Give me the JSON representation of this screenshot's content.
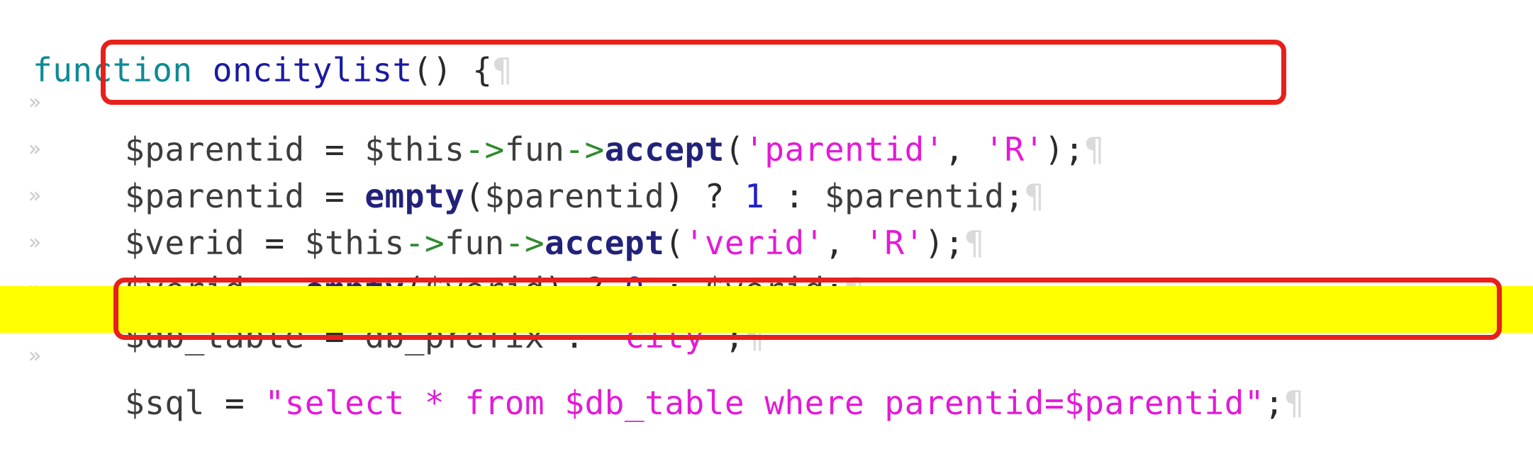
{
  "editor": {
    "lines": [
      {
        "tab": "",
        "pilcrow": "¶",
        "tokens": [
          {
            "t": "function",
            "c": "kw"
          },
          {
            "t": " ",
            "c": "op"
          },
          {
            "t": "oncitylist",
            "c": "fn"
          },
          {
            "t": "() {",
            "c": "pun"
          }
        ]
      },
      {
        "tab": "»",
        "pilcrow": "¶",
        "tokens": [
          {
            "t": "$parentid",
            "c": "var"
          },
          {
            "t": " = ",
            "c": "op"
          },
          {
            "t": "$this",
            "c": "var"
          },
          {
            "t": "->",
            "c": "arr"
          },
          {
            "t": "fun",
            "c": "var"
          },
          {
            "t": "->",
            "c": "arr"
          },
          {
            "t": "accept",
            "c": "mth"
          },
          {
            "t": "(",
            "c": "pun"
          },
          {
            "t": "'parentid'",
            "c": "str"
          },
          {
            "t": ", ",
            "c": "pun"
          },
          {
            "t": "'R'",
            "c": "str"
          },
          {
            "t": ");",
            "c": "pun"
          }
        ]
      },
      {
        "tab": "»",
        "pilcrow": "¶",
        "tokens": [
          {
            "t": "$parentid",
            "c": "var"
          },
          {
            "t": " = ",
            "c": "op"
          },
          {
            "t": "empty",
            "c": "mth"
          },
          {
            "t": "(",
            "c": "pun"
          },
          {
            "t": "$parentid",
            "c": "var"
          },
          {
            "t": ") ? ",
            "c": "pun"
          },
          {
            "t": "1",
            "c": "num"
          },
          {
            "t": " : ",
            "c": "pun"
          },
          {
            "t": "$parentid",
            "c": "var"
          },
          {
            "t": ";",
            "c": "pun"
          }
        ]
      },
      {
        "tab": "»",
        "pilcrow": "¶",
        "tokens": [
          {
            "t": "$verid",
            "c": "var"
          },
          {
            "t": " = ",
            "c": "op"
          },
          {
            "t": "$this",
            "c": "var"
          },
          {
            "t": "->",
            "c": "arr"
          },
          {
            "t": "fun",
            "c": "var"
          },
          {
            "t": "->",
            "c": "arr"
          },
          {
            "t": "accept",
            "c": "mth"
          },
          {
            "t": "(",
            "c": "pun"
          },
          {
            "t": "'verid'",
            "c": "str"
          },
          {
            "t": ", ",
            "c": "pun"
          },
          {
            "t": "'R'",
            "c": "str"
          },
          {
            "t": ");",
            "c": "pun"
          }
        ]
      },
      {
        "tab": "»",
        "pilcrow": "¶",
        "tokens": [
          {
            "t": "$verid",
            "c": "var"
          },
          {
            "t": " = ",
            "c": "op"
          },
          {
            "t": "empty",
            "c": "mth"
          },
          {
            "t": "(",
            "c": "pun"
          },
          {
            "t": "$verid",
            "c": "var"
          },
          {
            "t": ") ? ",
            "c": "pun"
          },
          {
            "t": "0",
            "c": "num"
          },
          {
            "t": " : ",
            "c": "pun"
          },
          {
            "t": "$verid",
            "c": "var"
          },
          {
            "t": ";",
            "c": "pun"
          }
        ]
      },
      {
        "tab": "»",
        "pilcrow": "¶",
        "tokens": [
          {
            "t": "$db_table",
            "c": "var"
          },
          {
            "t": " = ",
            "c": "op"
          },
          {
            "t": "db_prefix",
            "c": "var"
          },
          {
            "t": " . ",
            "c": "op"
          },
          {
            "t": "'city'",
            "c": "str"
          },
          {
            "t": ";",
            "c": "pun"
          }
        ]
      },
      {
        "tab": "»",
        "pilcrow": "¶",
        "tokens": [
          {
            "t": "$sql",
            "c": "var"
          },
          {
            "t": " = ",
            "c": "op"
          },
          {
            "t": "\"select * from $db_table where parentid=$parentid\"",
            "c": "str"
          },
          {
            "t": ";",
            "c": "pun"
          }
        ]
      }
    ],
    "highlighted_line": 7
  },
  "colors": {
    "highlight": "#ffff00",
    "annotation_box": "#e8201a",
    "keyword": "#0d8a96",
    "string": "#e31ad8",
    "number": "#2020cc"
  }
}
